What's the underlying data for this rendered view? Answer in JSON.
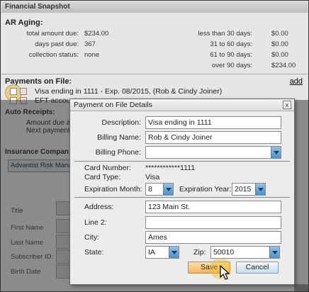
{
  "background": {
    "section_title": "Financial Snapshot",
    "aging_title": "AR Aging:",
    "aging": [
      {
        "label": "total amount due:",
        "value": "$234.00",
        "range": "less than 30 days:",
        "amount": "$0.00"
      },
      {
        "label": "days past due:",
        "value": "367",
        "range": "31 to 60 days:",
        "amount": "$0.00"
      },
      {
        "label": "collection status:",
        "value": "none",
        "range": "61 to 90 days:",
        "amount": "$0.00"
      },
      {
        "label": "",
        "value": "",
        "range": "over 90 days:",
        "amount": "$234.00"
      }
    ],
    "payments_title": "Payments on File:",
    "add_label": "add",
    "payment_rows": [
      "Visa ending in 1111 - Exp. 08/2015, (Rob & Cindy Joiner)",
      "EFT account"
    ],
    "auto_receipts_title": "Auto Receipts:",
    "auto_rows": [
      "Amount due a",
      "Next payment"
    ],
    "insurance_title": "Insurance Compan",
    "insurance_name": "Advantist Risk Mana",
    "side_labels": [
      "Title",
      "First Name",
      "Last Name",
      "Subscriber ID:",
      "Birth Date"
    ]
  },
  "dialog": {
    "title": "Payment on File Details",
    "close_label": "x",
    "description_label": "Description:",
    "description_value": "Visa ending in 1111",
    "billing_name_label": "Billing Name:",
    "billing_name_value": "Rob & Cindy Joiner",
    "billing_phone_label": "Billing Phone:",
    "billing_phone_value": "",
    "card_number_label": "Card Number:",
    "card_number_value": "************1111",
    "card_type_label": "Card Type:",
    "card_type_value": "Visa",
    "exp_month_label": "Expiration Month:",
    "exp_month_value": "8",
    "exp_year_label": "Expiration Year:",
    "exp_year_value": "2015",
    "address_label": "Address:",
    "address_value": "123 Main St.",
    "line2_label": "Line 2:",
    "line2_value": "",
    "city_label": "City:",
    "city_value": "Ames",
    "state_label": "State:",
    "state_value": "IA",
    "zip_label": "Zip:",
    "zip_value": "50010",
    "save_label": "Save",
    "cancel_label": "Cancel"
  },
  "colors": {
    "save_button": "#f3b45c",
    "dropdown_button": "#4f8fc7",
    "highlight": "#e6be3c"
  }
}
